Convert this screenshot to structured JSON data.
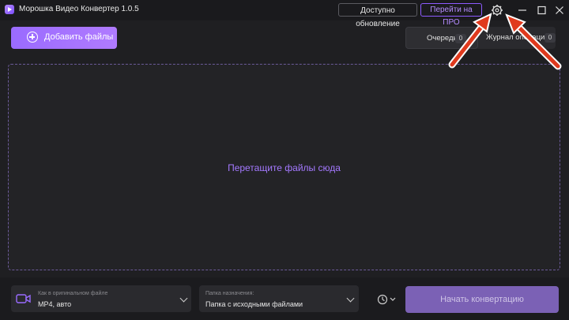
{
  "titlebar": {
    "app_title": "Морошка Видео Конвертер 1.0.5",
    "update_label": "Доступно обновление",
    "pro_label": "Перейти на ПРО"
  },
  "toolbar": {
    "add_files_label": "Добавить файлы",
    "tabs": [
      {
        "label": "Очередь",
        "count": "0"
      },
      {
        "label": "Журнал операций",
        "count": "0"
      }
    ]
  },
  "dropzone": {
    "hint": "Перетащите файлы сюда"
  },
  "footer": {
    "format": {
      "caption": "Как в оригинальном файле",
      "value": "MP4, авто"
    },
    "destination": {
      "caption": "Папка назначения:",
      "value": "Папка с исходными файлами"
    },
    "start_label": "Начать конвертацию"
  },
  "colors": {
    "accent": "#9a6bff",
    "annotation_arrow": "#e03a1e"
  },
  "icons": [
    "app-logo-icon",
    "gear-icon",
    "minimize-icon",
    "maximize-icon",
    "close-icon",
    "plus-circle-icon",
    "video-camera-icon",
    "timer-icon",
    "chevron-down-icon"
  ]
}
